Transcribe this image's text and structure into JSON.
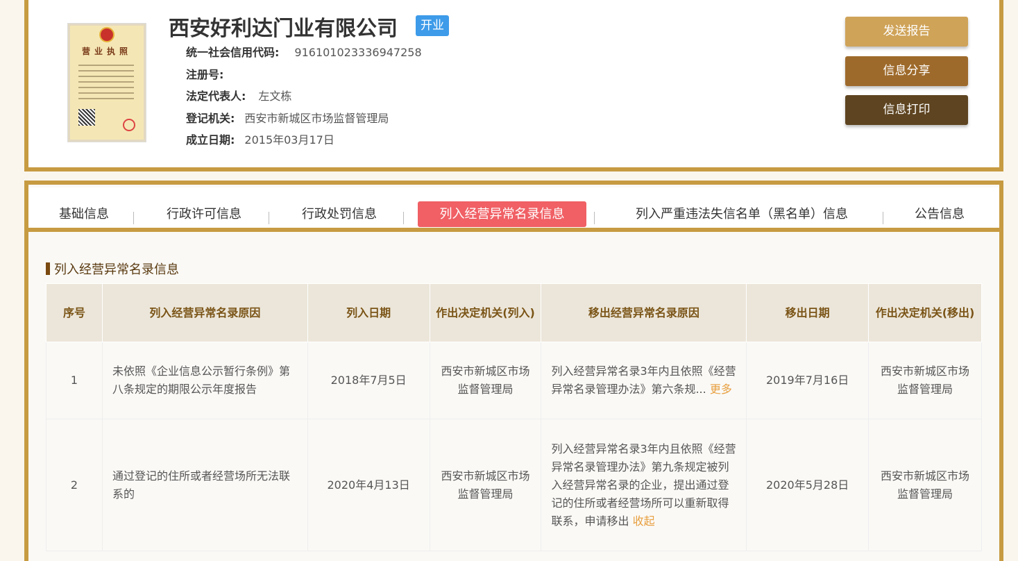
{
  "company": {
    "name": "西安好利达门业有限公司",
    "status": "开业",
    "license_title": "营业执照",
    "fields": [
      {
        "label": "统一社会信用代码:",
        "value": "916101023336947258"
      },
      {
        "label": "注册号:",
        "value": ""
      },
      {
        "label": "法定代表人:",
        "value": "左文栋"
      },
      {
        "label": "登记机关:",
        "value": "西安市新城区市场监督管理局"
      },
      {
        "label": "成立日期:",
        "value": "2015年03月17日"
      }
    ]
  },
  "actions": {
    "send_report": "发送报告",
    "share": "信息分享",
    "print": "信息打印"
  },
  "tabs": [
    {
      "label": "基础信息"
    },
    {
      "label": "行政许可信息"
    },
    {
      "label": "行政处罚信息"
    },
    {
      "label": "列入经营异常名录信息",
      "active": true
    },
    {
      "label": "列入严重违法失信名单（黑名单）信息"
    },
    {
      "label": "公告信息"
    }
  ],
  "section": {
    "title": "列入经营异常名录信息"
  },
  "table": {
    "headers": [
      "序号",
      "列入经营异常名录原因",
      "列入日期",
      "作出决定机关(列入)",
      "移出经营异常名录原因",
      "移出日期",
      "作出决定机关(移出)"
    ],
    "rows": [
      {
        "no": "1",
        "reason_in": "未依照《企业信息公示暂行条例》第八条规定的期限公示年度报告",
        "date_in": "2018年7月5日",
        "authority_in": "西安市新城区市场监督管理局",
        "reason_out": "列入经营异常名录3年内且依照《经营异常名录管理办法》第六条规...",
        "toggle": "更多",
        "date_out": "2019年7月16日",
        "authority_out": "西安市新城区市场监督管理局"
      },
      {
        "no": "2",
        "reason_in": "通过登记的住所或者经营场所无法联系的",
        "date_in": "2020年4月13日",
        "authority_in": "西安市新城区市场监督管理局",
        "reason_out": "列入经营异常名录3年内且依照《经营异常名录管理办法》第九条规定被列入经营异常名录的企业，提出通过登记的住所或者经营场所可以重新取得联系，申请移出",
        "toggle": "收起",
        "date_out": "2020年5月28日",
        "authority_out": "西安市新城区市场监督管理局"
      }
    ]
  },
  "colors": {
    "border_gold": "#c79b42",
    "status_blue": "#3d9be9",
    "active_tab": "#f06065",
    "link_orange": "#e8a041",
    "btn_report": "#cfa358",
    "btn_share": "#9e6a2b",
    "btn_print": "#5e4420"
  }
}
